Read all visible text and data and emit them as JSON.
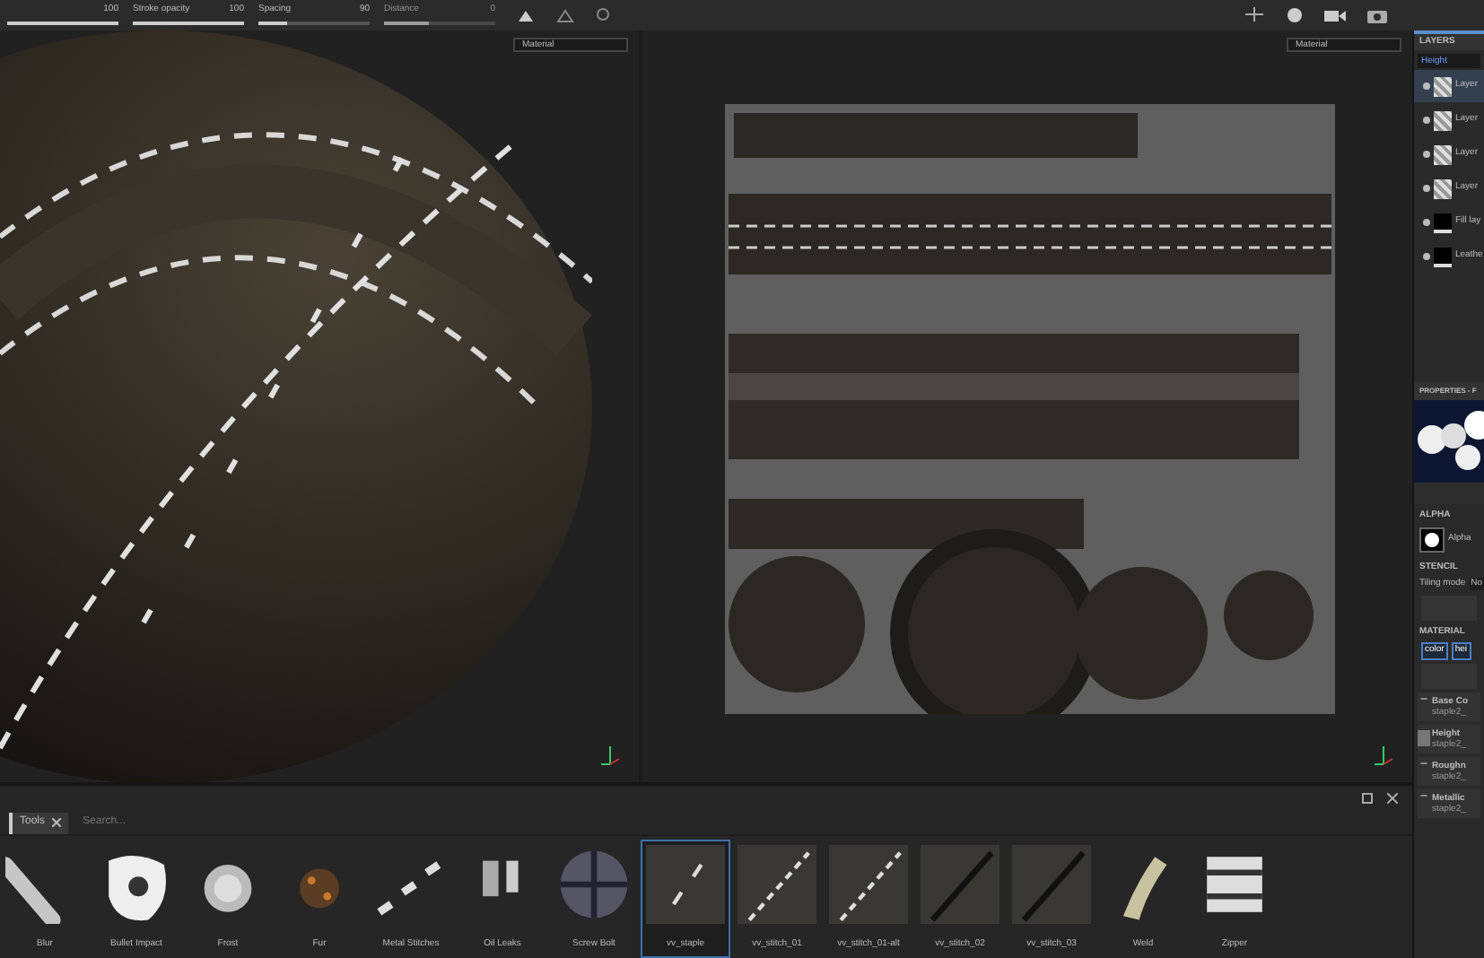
{
  "toolbar": {
    "sliders": [
      {
        "reading": "100",
        "level": 1,
        "disabled": false
      },
      {
        "label": "Stroke opacity",
        "reading": "100",
        "level": 1,
        "disabled": false
      },
      {
        "label": "Spacing",
        "reading": "90",
        "level": 0.25,
        "disabled": false
      },
      {
        "label": "Distance",
        "reading": "0",
        "level": 0.4,
        "disabled": true
      }
    ]
  },
  "viewports": [
    {
      "dropdown": "Material"
    },
    {
      "dropdown": "Material"
    }
  ],
  "layers": {
    "title": "LAYERS",
    "channel": "Height",
    "items": [
      {
        "name": "Layer",
        "kind": "paint",
        "selected": true
      },
      {
        "name": "Layer",
        "kind": "paint",
        "selected": false
      },
      {
        "name": "Layer",
        "kind": "paint",
        "selected": false
      },
      {
        "name": "Layer",
        "kind": "paint",
        "selected": false
      },
      {
        "name": "Fill lay",
        "kind": "fill",
        "selected": false
      },
      {
        "name": "Leathe",
        "kind": "fill",
        "selected": false
      }
    ]
  },
  "properties": {
    "title": "PROPERTIES - F",
    "alpha_heading": "ALPHA",
    "alpha_name": "Alpha",
    "stencil_heading": "STENCIL",
    "tiling_label": "Tiling mode",
    "tiling_value": "No",
    "material_heading": "MATERIAL",
    "material_toggles": [
      {
        "label": "color"
      },
      {
        "label": "hei"
      }
    ],
    "channels": [
      {
        "name": "Base Co",
        "source": "staple2_",
        "kind": "empty"
      },
      {
        "name": "Height",
        "source": "staple2_",
        "kind": "texture"
      },
      {
        "name": "Roughn",
        "source": "staple2_",
        "kind": "empty"
      },
      {
        "name": "Metallic",
        "source": "staple2_",
        "kind": "empty"
      }
    ]
  },
  "shelf": {
    "tab": "Tools",
    "search": {
      "placeholder": "Search..."
    },
    "items": [
      {
        "label": "Blur",
        "kind": "blur",
        "selected": false
      },
      {
        "label": "Bullet Impact",
        "kind": "splat",
        "selected": false
      },
      {
        "label": "Frost",
        "kind": "frost",
        "selected": false
      },
      {
        "label": "Fur",
        "kind": "fur",
        "selected": false
      },
      {
        "label": "Metal Stitches",
        "kind": "staples",
        "selected": false
      },
      {
        "label": "Oil Leaks",
        "kind": "leaks",
        "selected": false
      },
      {
        "label": "Screw Bolt",
        "kind": "bolt",
        "selected": false
      },
      {
        "label": "vv_staple",
        "kind": "staple",
        "selected": true
      },
      {
        "label": "vv_stitch_01",
        "kind": "stitch",
        "selected": false
      },
      {
        "label": "vv_stitch_01-alt",
        "kind": "stitch",
        "selected": false
      },
      {
        "label": "vv_stitch_02",
        "kind": "seam",
        "selected": false
      },
      {
        "label": "vv_stitch_03",
        "kind": "seam",
        "selected": false
      },
      {
        "label": "Weld",
        "kind": "weld",
        "selected": false
      },
      {
        "label": "Zipper",
        "kind": "zipper",
        "selected": false
      }
    ]
  }
}
